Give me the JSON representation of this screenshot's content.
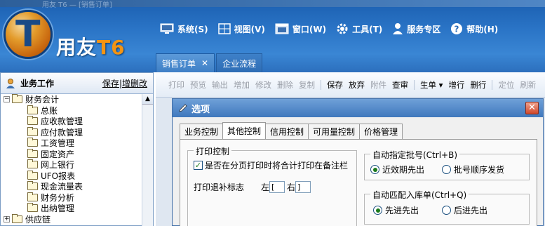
{
  "header": {
    "title_bar_faded": "用友 T6 — [销售订单]",
    "logo_letter": "T",
    "brand_name": "用友",
    "brand_version": "T6"
  },
  "menu": [
    {
      "label": "系统(S)",
      "icon": "monitor-icon"
    },
    {
      "label": "视图(V)",
      "icon": "grid-icon"
    },
    {
      "label": "窗口(W)",
      "icon": "window-icon"
    },
    {
      "label": "工具(T)",
      "icon": "gear-icon"
    },
    {
      "label": "服务专区",
      "icon": "user-icon"
    },
    {
      "label": "帮助(H)",
      "icon": "help-icon"
    }
  ],
  "tabs": {
    "active": "销售订单",
    "close": "✕",
    "inactive": "企业流程"
  },
  "left_panel": {
    "title": "业务工作",
    "link_save": "保存",
    "link_edit": "增删改",
    "tree_root": "财务会计",
    "tree_items": [
      "总账",
      "应收款管理",
      "应付款管理",
      "工资管理",
      "固定资产",
      "网上银行",
      "UFO报表",
      "现金流量表",
      "财务分析",
      "出纳管理"
    ],
    "tree_next": "供应链"
  },
  "toolbar": {
    "disabled_1": [
      "打印",
      "预览",
      "输出",
      "增加",
      "修改",
      "删除",
      "复制"
    ],
    "enabled_1": [
      "保存",
      "放弃"
    ],
    "disabled_2": [
      "附件"
    ],
    "enabled_2": [
      "查审"
    ],
    "enabled_3": [
      "生单 ▾",
      "增行",
      "删行"
    ],
    "disabled_3": [
      "定位",
      "刷新"
    ]
  },
  "dialog": {
    "title": "选项",
    "close": "✕",
    "tabs": [
      "业务控制",
      "其他控制",
      "信用控制",
      "可用量控制",
      "价格管理"
    ],
    "active_tab_index": 1,
    "print_group": {
      "title": "打印控制",
      "checkbox_label": "是否在分页打印时将合计打印在备注栏",
      "checkbox_checked": true,
      "fill_label": "打印退补标志",
      "left_label": "左",
      "left_value": "[",
      "right_label": "右",
      "right_value": "]"
    },
    "batch_group": {
      "title": "自动指定批号(Ctrl+B)",
      "option_1": "近效期先出",
      "option_2": "批号顺序发货",
      "selected": 1
    },
    "match_group": {
      "title": "自动匹配入库单(Ctrl+Q)",
      "option_1": "先进先出",
      "option_2": "后进先出",
      "selected": 1
    }
  }
}
